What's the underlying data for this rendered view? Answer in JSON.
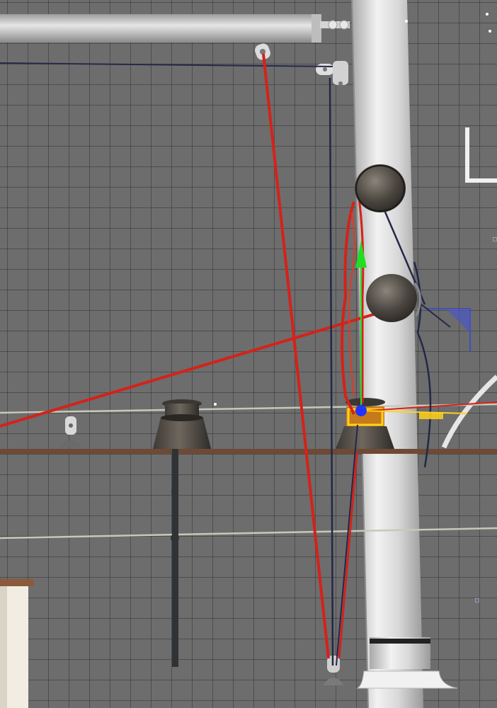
{
  "viewport": {
    "background_color": "#6d6d6d",
    "grid_line_color": "#4a4a4a",
    "selected_rig_color": "#e0261b",
    "rope_dark_color": "#22284a",
    "gizmo_y_axis_color": "#22dd22",
    "gizmo_origin_color": "#2233ff",
    "selection_highlight_color": "#ffd21a",
    "hud_markers": [
      "□",
      "□"
    ]
  },
  "scene_objects": [
    {
      "name": "boom",
      "icon": "boom-spar"
    },
    {
      "name": "mast",
      "icon": "mast-column"
    },
    {
      "name": "upper-winch",
      "icon": "winch"
    },
    {
      "name": "mid-winch",
      "icon": "winch"
    },
    {
      "name": "deck-winch-left",
      "icon": "winch"
    },
    {
      "name": "deck-winch-selected",
      "icon": "winch"
    },
    {
      "name": "stanchion",
      "icon": "stanchion-post"
    },
    {
      "name": "toe-rail",
      "icon": "rail"
    },
    {
      "name": "lifelines",
      "icon": "wire"
    },
    {
      "name": "halyard-selected",
      "icon": "rope"
    },
    {
      "name": "cabin-top",
      "icon": "deck-block"
    }
  ]
}
